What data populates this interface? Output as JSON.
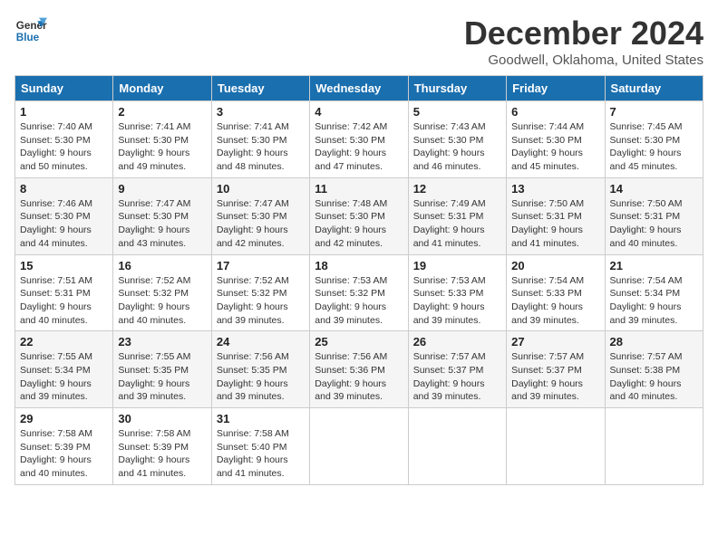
{
  "logo": {
    "line1": "General",
    "line2": "Blue"
  },
  "title": "December 2024",
  "subtitle": "Goodwell, Oklahoma, United States",
  "weekdays": [
    "Sunday",
    "Monday",
    "Tuesday",
    "Wednesday",
    "Thursday",
    "Friday",
    "Saturday"
  ],
  "weeks": [
    [
      {
        "day": "1",
        "sunrise": "Sunrise: 7:40 AM",
        "sunset": "Sunset: 5:30 PM",
        "daylight": "Daylight: 9 hours and 50 minutes."
      },
      {
        "day": "2",
        "sunrise": "Sunrise: 7:41 AM",
        "sunset": "Sunset: 5:30 PM",
        "daylight": "Daylight: 9 hours and 49 minutes."
      },
      {
        "day": "3",
        "sunrise": "Sunrise: 7:41 AM",
        "sunset": "Sunset: 5:30 PM",
        "daylight": "Daylight: 9 hours and 48 minutes."
      },
      {
        "day": "4",
        "sunrise": "Sunrise: 7:42 AM",
        "sunset": "Sunset: 5:30 PM",
        "daylight": "Daylight: 9 hours and 47 minutes."
      },
      {
        "day": "5",
        "sunrise": "Sunrise: 7:43 AM",
        "sunset": "Sunset: 5:30 PM",
        "daylight": "Daylight: 9 hours and 46 minutes."
      },
      {
        "day": "6",
        "sunrise": "Sunrise: 7:44 AM",
        "sunset": "Sunset: 5:30 PM",
        "daylight": "Daylight: 9 hours and 45 minutes."
      },
      {
        "day": "7",
        "sunrise": "Sunrise: 7:45 AM",
        "sunset": "Sunset: 5:30 PM",
        "daylight": "Daylight: 9 hours and 45 minutes."
      }
    ],
    [
      {
        "day": "8",
        "sunrise": "Sunrise: 7:46 AM",
        "sunset": "Sunset: 5:30 PM",
        "daylight": "Daylight: 9 hours and 44 minutes."
      },
      {
        "day": "9",
        "sunrise": "Sunrise: 7:47 AM",
        "sunset": "Sunset: 5:30 PM",
        "daylight": "Daylight: 9 hours and 43 minutes."
      },
      {
        "day": "10",
        "sunrise": "Sunrise: 7:47 AM",
        "sunset": "Sunset: 5:30 PM",
        "daylight": "Daylight: 9 hours and 42 minutes."
      },
      {
        "day": "11",
        "sunrise": "Sunrise: 7:48 AM",
        "sunset": "Sunset: 5:30 PM",
        "daylight": "Daylight: 9 hours and 42 minutes."
      },
      {
        "day": "12",
        "sunrise": "Sunrise: 7:49 AM",
        "sunset": "Sunset: 5:31 PM",
        "daylight": "Daylight: 9 hours and 41 minutes."
      },
      {
        "day": "13",
        "sunrise": "Sunrise: 7:50 AM",
        "sunset": "Sunset: 5:31 PM",
        "daylight": "Daylight: 9 hours and 41 minutes."
      },
      {
        "day": "14",
        "sunrise": "Sunrise: 7:50 AM",
        "sunset": "Sunset: 5:31 PM",
        "daylight": "Daylight: 9 hours and 40 minutes."
      }
    ],
    [
      {
        "day": "15",
        "sunrise": "Sunrise: 7:51 AM",
        "sunset": "Sunset: 5:31 PM",
        "daylight": "Daylight: 9 hours and 40 minutes."
      },
      {
        "day": "16",
        "sunrise": "Sunrise: 7:52 AM",
        "sunset": "Sunset: 5:32 PM",
        "daylight": "Daylight: 9 hours and 40 minutes."
      },
      {
        "day": "17",
        "sunrise": "Sunrise: 7:52 AM",
        "sunset": "Sunset: 5:32 PM",
        "daylight": "Daylight: 9 hours and 39 minutes."
      },
      {
        "day": "18",
        "sunrise": "Sunrise: 7:53 AM",
        "sunset": "Sunset: 5:32 PM",
        "daylight": "Daylight: 9 hours and 39 minutes."
      },
      {
        "day": "19",
        "sunrise": "Sunrise: 7:53 AM",
        "sunset": "Sunset: 5:33 PM",
        "daylight": "Daylight: 9 hours and 39 minutes."
      },
      {
        "day": "20",
        "sunrise": "Sunrise: 7:54 AM",
        "sunset": "Sunset: 5:33 PM",
        "daylight": "Daylight: 9 hours and 39 minutes."
      },
      {
        "day": "21",
        "sunrise": "Sunrise: 7:54 AM",
        "sunset": "Sunset: 5:34 PM",
        "daylight": "Daylight: 9 hours and 39 minutes."
      }
    ],
    [
      {
        "day": "22",
        "sunrise": "Sunrise: 7:55 AM",
        "sunset": "Sunset: 5:34 PM",
        "daylight": "Daylight: 9 hours and 39 minutes."
      },
      {
        "day": "23",
        "sunrise": "Sunrise: 7:55 AM",
        "sunset": "Sunset: 5:35 PM",
        "daylight": "Daylight: 9 hours and 39 minutes."
      },
      {
        "day": "24",
        "sunrise": "Sunrise: 7:56 AM",
        "sunset": "Sunset: 5:35 PM",
        "daylight": "Daylight: 9 hours and 39 minutes."
      },
      {
        "day": "25",
        "sunrise": "Sunrise: 7:56 AM",
        "sunset": "Sunset: 5:36 PM",
        "daylight": "Daylight: 9 hours and 39 minutes."
      },
      {
        "day": "26",
        "sunrise": "Sunrise: 7:57 AM",
        "sunset": "Sunset: 5:37 PM",
        "daylight": "Daylight: 9 hours and 39 minutes."
      },
      {
        "day": "27",
        "sunrise": "Sunrise: 7:57 AM",
        "sunset": "Sunset: 5:37 PM",
        "daylight": "Daylight: 9 hours and 39 minutes."
      },
      {
        "day": "28",
        "sunrise": "Sunrise: 7:57 AM",
        "sunset": "Sunset: 5:38 PM",
        "daylight": "Daylight: 9 hours and 40 minutes."
      }
    ],
    [
      {
        "day": "29",
        "sunrise": "Sunrise: 7:58 AM",
        "sunset": "Sunset: 5:39 PM",
        "daylight": "Daylight: 9 hours and 40 minutes."
      },
      {
        "day": "30",
        "sunrise": "Sunrise: 7:58 AM",
        "sunset": "Sunset: 5:39 PM",
        "daylight": "Daylight: 9 hours and 41 minutes."
      },
      {
        "day": "31",
        "sunrise": "Sunrise: 7:58 AM",
        "sunset": "Sunset: 5:40 PM",
        "daylight": "Daylight: 9 hours and 41 minutes."
      },
      null,
      null,
      null,
      null
    ]
  ]
}
